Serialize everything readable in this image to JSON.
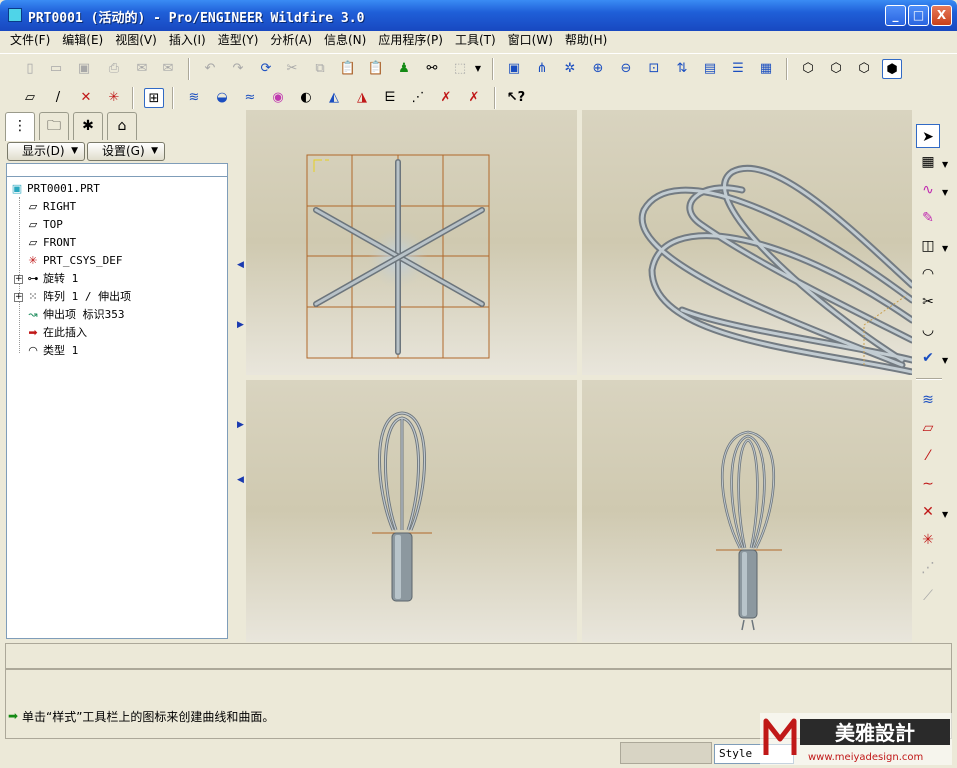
{
  "window": {
    "title": "PRT0001 (活动的) - Pro/ENGINEER Wildfire 3.0",
    "min_label": "_",
    "max_label": "□",
    "close_label": "X"
  },
  "menubar": {
    "items": [
      "文件(F)",
      "编辑(E)",
      "视图(V)",
      "插入(I)",
      "造型(Y)",
      "分析(A)",
      "信息(N)",
      "应用程序(P)",
      "工具(T)",
      "窗口(W)",
      "帮助(H)"
    ]
  },
  "left_panel": {
    "show_button": "显示(D)",
    "settings_button": "设置(G)",
    "tree": {
      "root": "PRT0001.PRT",
      "items": [
        {
          "label": "RIGHT",
          "icon": "datum-plane-icon"
        },
        {
          "label": "TOP",
          "icon": "datum-plane-icon"
        },
        {
          "label": "FRONT",
          "icon": "datum-plane-icon"
        },
        {
          "label": "PRT_CSYS_DEF",
          "icon": "csys-icon"
        },
        {
          "label": "旋转 1",
          "icon": "revolve-icon"
        },
        {
          "label": "阵列 1 / 伸出项",
          "icon": "pattern-icon"
        },
        {
          "label": "伸出项 标识353",
          "icon": "sweep-icon"
        },
        {
          "label": "在此插入",
          "icon": "insert-here-arrow-icon"
        },
        {
          "label": "类型 1",
          "icon": "style-feature-icon"
        }
      ]
    }
  },
  "status": {
    "message": "单击“样式”工具栏上的图标来创建曲线和曲面。",
    "style_field": "Style"
  },
  "watermark": {
    "text": "美雅設計",
    "url": "www.meiyadesign.com"
  },
  "colors": {
    "title_bar": "#1f5fd8",
    "viewport_bg": "#d4cfb8",
    "model_color": "#a8b4bc",
    "grid_color": "#b0682a"
  }
}
